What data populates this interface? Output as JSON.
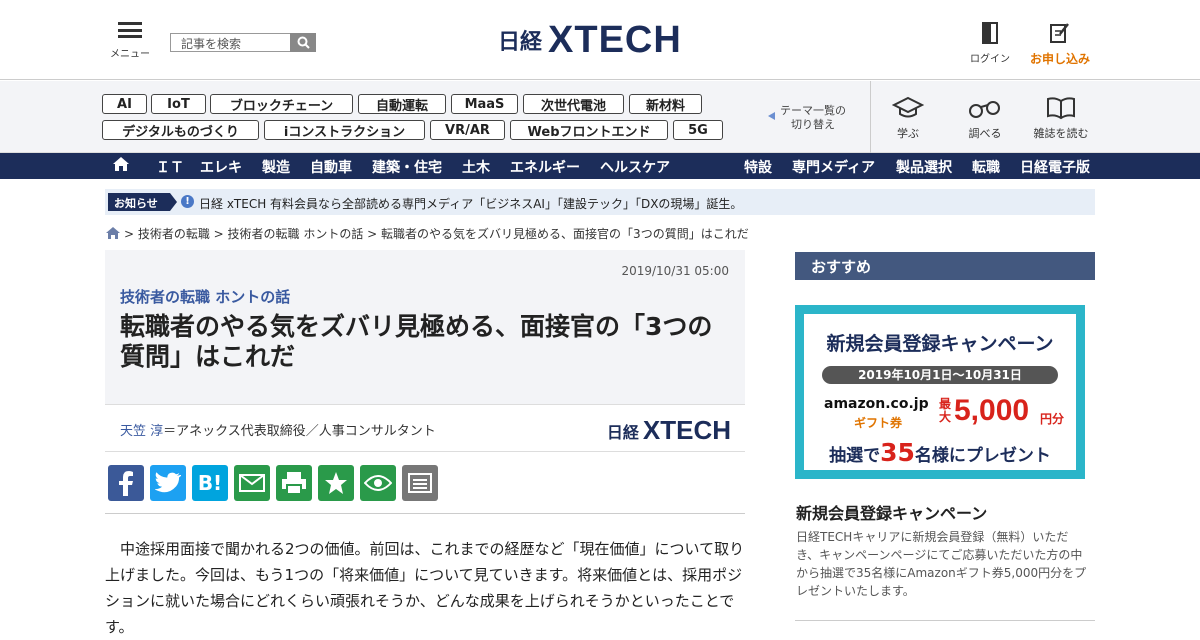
{
  "header": {
    "menu_label": "メニュー",
    "search_placeholder": "記事を検索",
    "logo_nikkei": "日経",
    "logo_xtech": "XTECH",
    "login_label": "ログイン",
    "apply_label": "お申し込み"
  },
  "tags": [
    "AI",
    "IoT",
    "ブロックチェーン",
    "自動運転",
    "MaaS",
    "次世代電池",
    "新材料",
    "デジタルものづくり",
    "iコンストラクション",
    "VR/AR",
    "Webフロントエンド",
    "5G"
  ],
  "theme_switch": {
    "line1": "テーマ一覧の",
    "line2": "切り替え"
  },
  "quick_links": [
    {
      "label": "学ぶ",
      "icon": "graduation-cap-icon"
    },
    {
      "label": "調べる",
      "icon": "binoculars-icon"
    },
    {
      "label": "雑誌を読む",
      "icon": "book-icon"
    }
  ],
  "nav": {
    "left": [
      "ＩＴ",
      "エレキ",
      "製造",
      "自動車",
      "建築・住宅",
      "土木",
      "エネルギー",
      "ヘルスケア"
    ],
    "right": [
      "特設",
      "専門メディア",
      "製品選択",
      "転職",
      "日経電子版"
    ]
  },
  "notice": {
    "label": "お知らせ",
    "text": "日経 xTECH 有料会員なら全部読める専門メディア「ビジネスAI」「建設テック」「DXの現場」誕生。"
  },
  "breadcrumb": "> 技術者の転職 > 技術者の転職 ホントの話 > 転職者のやる気をズバリ見極める、面接官の「3つの質問」はこれだ",
  "article": {
    "date": "2019/10/31 05:00",
    "series": "技術者の転職 ホントの話",
    "title": "転職者のやる気をズバリ見極める、面接官の「3つの質問」はこれだ",
    "author_name": "天笠 淳",
    "author_role": "＝アネックス代表取締役／人事コンサルタント",
    "body": "中途採用面接で聞かれる2つの価値。前回は、これまでの経歴など「現在価値」について取り上げました。今回は、もう1つの「将来価値」について見ていきます。将来価値とは、採用ポジションに就いた場合にどれくらい頑張れそうか、どんな成果を上げられそうかといったことです。"
  },
  "share_buttons": [
    {
      "name": "facebook",
      "icon": "facebook-icon",
      "color": "#3b5998"
    },
    {
      "name": "twitter",
      "icon": "twitter-icon",
      "color": "#1da1f2"
    },
    {
      "name": "hatena",
      "icon": "hatena-bookmark-icon",
      "color": "#00a4de"
    },
    {
      "name": "mail",
      "icon": "mail-icon",
      "color": "#2a9a4a"
    },
    {
      "name": "print",
      "icon": "print-icon",
      "color": "#2a9a4a"
    },
    {
      "name": "favorite",
      "icon": "star-icon",
      "color": "#2a9a4a"
    },
    {
      "name": "watch",
      "icon": "eye-icon",
      "color": "#2a9a4a"
    },
    {
      "name": "memo",
      "icon": "memo-icon",
      "color": "#777777"
    }
  ],
  "sidebar": {
    "heading": "おすすめ",
    "banner": {
      "title": "新規会員登録キャンペーン",
      "period": "2019年10月1日〜10月31日",
      "amazon": "amazon.co.jp",
      "gift": "ギフト券",
      "max": "最大",
      "amount": "5,000",
      "yen": "円分",
      "draw_prefix": "抽選で",
      "draw_count": "35",
      "draw_suffix": "名様にプレゼント"
    },
    "campaign_title": "新規会員登録キャンペーン",
    "campaign_desc": "日経TECHキャリアに新規会員登録（無料）いただき、キャンペーンページにてご応募いただいた方の中から抽選で35名様にAmazonギフト券5,000円分をプレゼントいたします。"
  },
  "colors": {
    "navy": "#1c2d5a",
    "accent_orange": "#e07400",
    "link_blue": "#3a5aa0",
    "banner_teal": "#2bb5c9",
    "red": "#d8231b"
  }
}
